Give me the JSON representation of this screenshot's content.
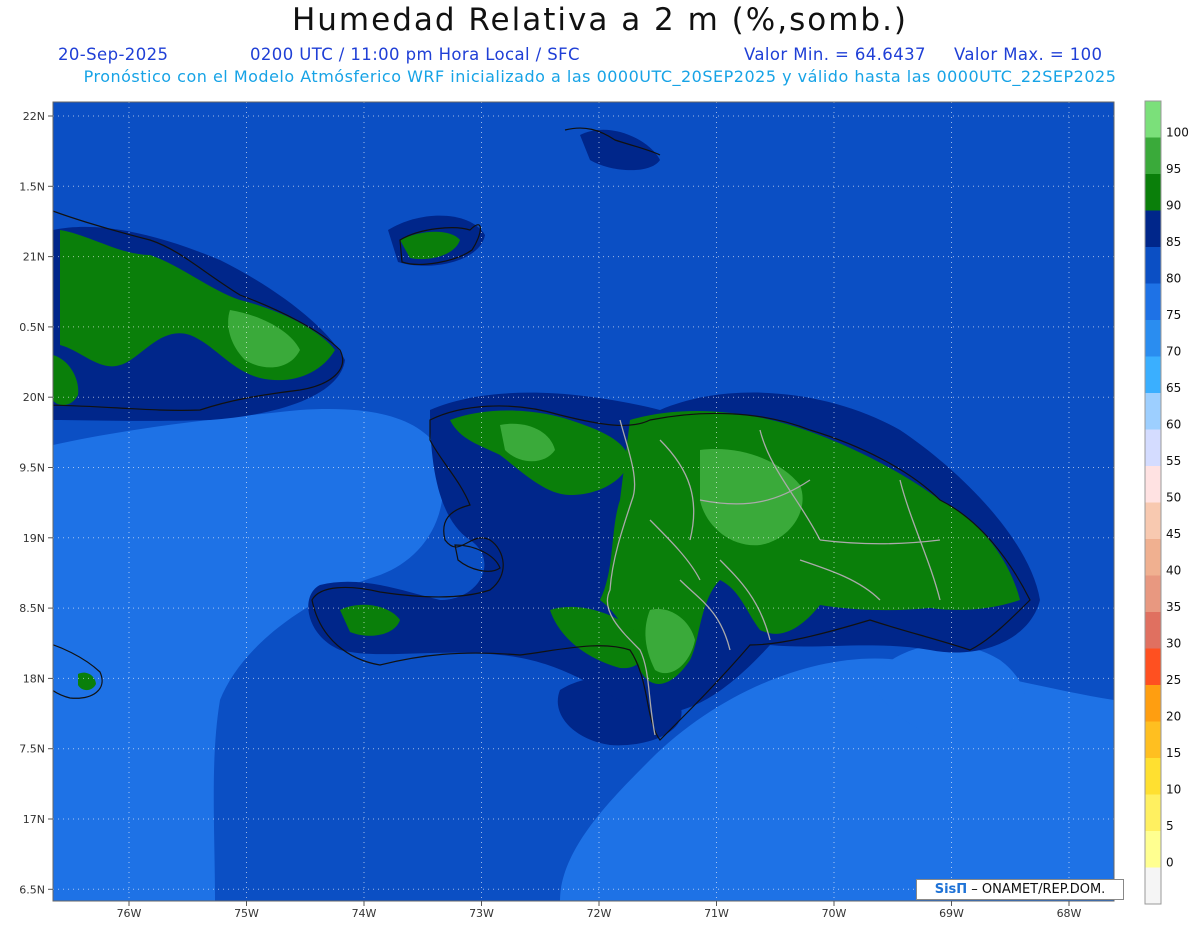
{
  "header": {
    "title": "Humedad Relativa a 2 m (%,somb.)",
    "date": "20-Sep-2025",
    "time": "0200 UTC / 11:00 pm Hora Local / SFC",
    "valmin": "Valor Min. = 64.6437",
    "valmax": "Valor Max. = 100",
    "subtitle": "Pronóstico con el Modelo Atmósferico WRF inicializado a las 0000UTC_20SEP2025 y válido hasta las  0000UTC_22SEP2025"
  },
  "axes": {
    "lon_labels": [
      "76W",
      "75W",
      "74W",
      "73W",
      "72W",
      "71W",
      "70W",
      "69W",
      "68W"
    ],
    "lat_labels": [
      "22N",
      "1.5N",
      "21N",
      "0.5N",
      "20N",
      "9.5N",
      "19N",
      "8.5N",
      "18N",
      "7.5N",
      "17N",
      "6.5N"
    ]
  },
  "colorbar": {
    "labels": [
      "100",
      "95",
      "90",
      "85",
      "80",
      "75",
      "70",
      "65",
      "60",
      "55",
      "50",
      "45",
      "40",
      "35",
      "30",
      "25",
      "20",
      "15",
      "10",
      "5",
      "0"
    ],
    "colors": [
      "#7be07a",
      "#3aaa3a",
      "#0a7f0a",
      "#00268a",
      "#0b4fc4",
      "#1e72e6",
      "#2a8df0",
      "#3aafff",
      "#9dcfff",
      "#d4dcff",
      "#ffe2e2",
      "#f8c9b0",
      "#f0b090",
      "#e89880",
      "#e07060",
      "#ff5020",
      "#ff9e10",
      "#ffbf20",
      "#ffe030",
      "#fff060",
      "#ffff90",
      "#f5f5f5"
    ]
  },
  "map": {
    "colors": {
      "sea": "#0b4fc4",
      "sea_light": "#1e72e6",
      "deep": "#00268a",
      "green": "#0a7f0a",
      "light_green": "#3aaa3a",
      "coast": "#111111",
      "border": "#aaaaaa"
    }
  },
  "credit": {
    "logo": "SisΠ",
    "text": " – ONAMET/REP.DOM."
  }
}
